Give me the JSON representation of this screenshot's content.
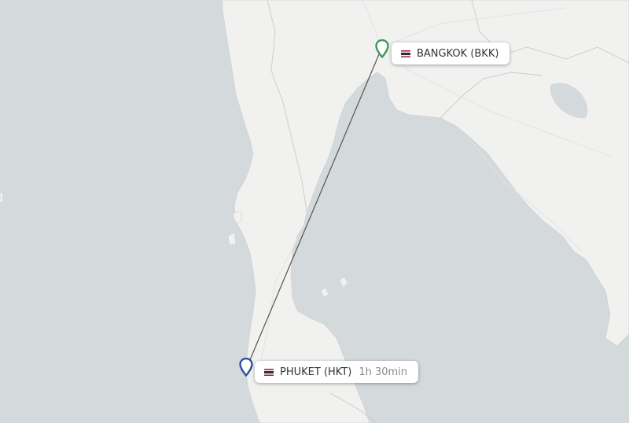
{
  "origin": {
    "city_label": "BANGKOK (BKK)",
    "pin_color": "#3b9a57",
    "flag_icon": "thailand-flag-icon"
  },
  "destination": {
    "city_label": "PHUKET (HKT)",
    "duration": "1h 30min",
    "pin_color": "#2d4fa3",
    "flag_icon": "thailand-flag-icon"
  },
  "colors": {
    "water": "#d4d9dc",
    "land": "#f1f1f0",
    "route_line": "#555555"
  }
}
